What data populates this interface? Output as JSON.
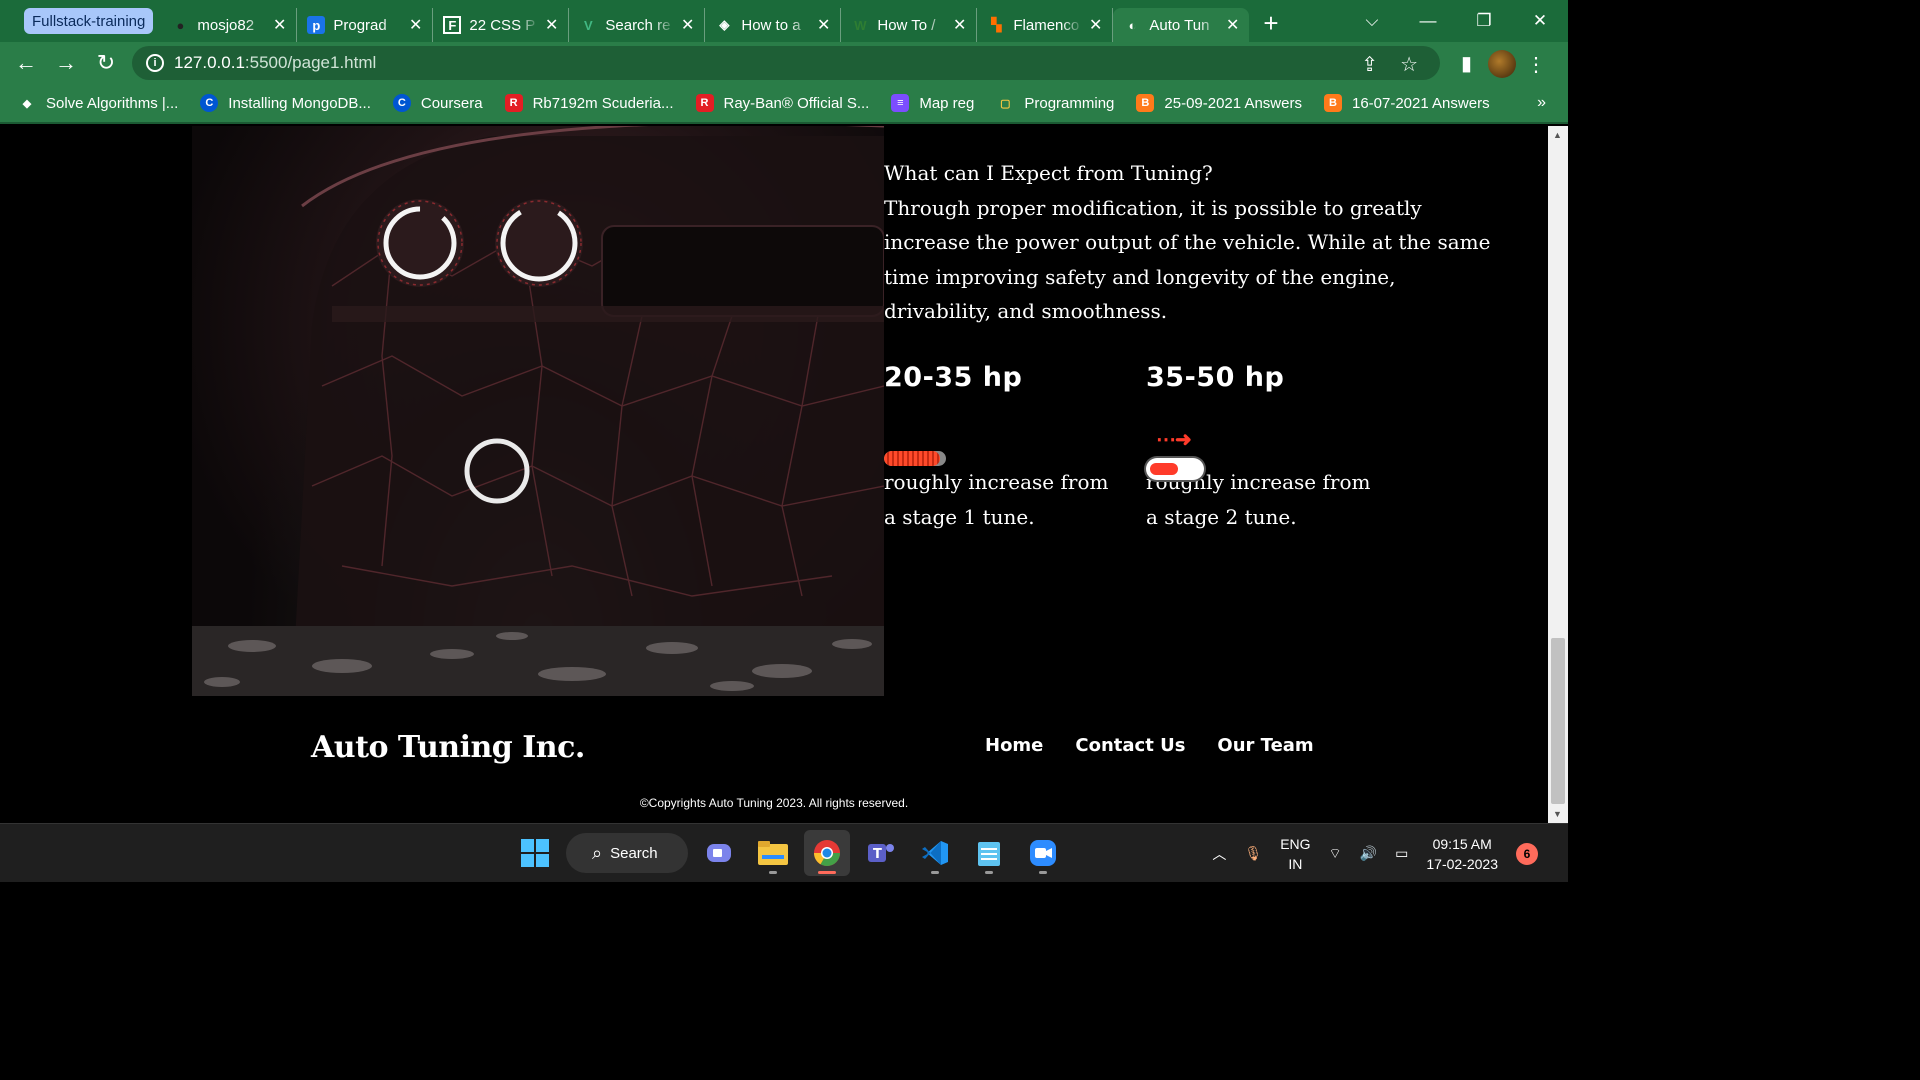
{
  "browser": {
    "tab_group_label": "Fullstack-training",
    "tabs": [
      {
        "title": "mosjo82",
        "favicon": "github-icon",
        "active": false
      },
      {
        "title": "Prograd",
        "favicon": "prograd-icon",
        "active": false
      },
      {
        "title": "22 CSS P",
        "favicon": "f-icon",
        "active": false
      },
      {
        "title": "Search re",
        "favicon": "v-icon",
        "active": false
      },
      {
        "title": "How to a",
        "favicon": "codepen-icon",
        "active": false
      },
      {
        "title": "How To /",
        "favicon": "w-icon",
        "active": false
      },
      {
        "title": "Flamenco",
        "favicon": "flamenco-icon",
        "active": false
      },
      {
        "title": "Auto Tun",
        "favicon": "globe-icon",
        "active": true
      }
    ],
    "address": {
      "host": "127.0.0.1",
      "path": ":5500/page1.html"
    },
    "bookmarks": [
      {
        "label": "Solve Algorithms |...",
        "icon": "hackerrank-icon",
        "color": "#ffffff"
      },
      {
        "label": "Installing MongoDB...",
        "icon": "coursera-icon",
        "color": "#0056d2"
      },
      {
        "label": "Coursera",
        "icon": "coursera-icon",
        "color": "#0056d2"
      },
      {
        "label": "Rb7192m Scuderia...",
        "icon": "rayban-icon",
        "color": "#e31e24"
      },
      {
        "label": "Ray-Ban® Official S...",
        "icon": "rayban-icon",
        "color": "#e31e24"
      },
      {
        "label": "Map reg",
        "icon": "list-icon",
        "color": "#7c4dff"
      },
      {
        "label": "Programming",
        "icon": "folder-icon",
        "color": "#2a7d48"
      },
      {
        "label": "25-09-2021 Answers",
        "icon": "blogger-icon",
        "color": "#ff7a1a"
      },
      {
        "label": "16-07-2021 Answers",
        "icon": "blogger-icon",
        "color": "#ff7a1a"
      }
    ]
  },
  "page": {
    "question": "What can I Expect from Tuning?",
    "intro": "Through proper modification, it is possible to greatly increase the power output of the vehicle. While at the same time improving safety and longevity of the engine, drivability, and smoothness.",
    "stages": [
      {
        "hp": "20-35 hp",
        "desc": "roughly increase from a stage 1 tune.",
        "level": 0.9
      },
      {
        "hp": "35-50 hp",
        "desc": "roughly increase from a stage 2 tune.",
        "level": 0.55
      }
    ],
    "footer": {
      "brand": "Auto Tuning Inc.",
      "nav": [
        "Home",
        "Contact Us",
        "Our Team"
      ],
      "copyright": "©Copyrights Auto Tuning 2023. All rights reserved."
    }
  },
  "taskbar": {
    "search_label": "Search",
    "lang_top": "ENG",
    "lang_bottom": "IN",
    "time": "09:15 AM",
    "date": "17-02-2023",
    "notifications": "6"
  }
}
